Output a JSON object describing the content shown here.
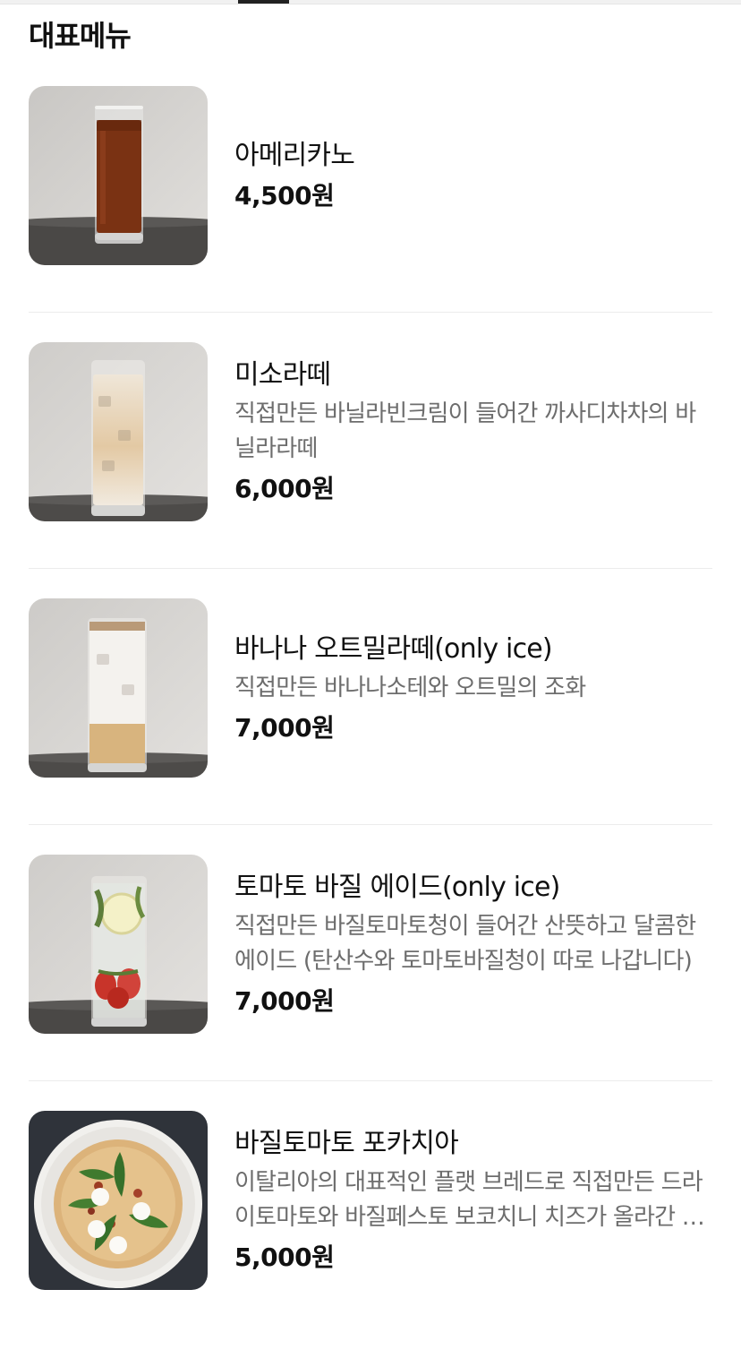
{
  "section": {
    "title": "대표메뉴"
  },
  "menu": [
    {
      "name": "아메리카노",
      "description": "",
      "price": "4,500원",
      "image_icon": "iced-americano-image"
    },
    {
      "name": "미소라떼",
      "description": "직접만든 바닐라빈크림이 들어간 까사디차차의 바닐라라떼",
      "price": "6,000원",
      "image_icon": "iced-latte-image"
    },
    {
      "name": "바나나 오트밀라떼(only ice)",
      "description": "직접만든 바나나소테와 오트밀의 조화",
      "price": "7,000원",
      "image_icon": "banana-oatmeal-latte-image"
    },
    {
      "name": "토마토 바질 에이드(only ice)",
      "description": "직접만든 바질토마토청이 들어간 산뜻하고 달콤한 에이드 (탄산수와 토마토바질청이 따로 나갑니다)",
      "price": "7,000원",
      "image_icon": "tomato-basil-ade-image"
    },
    {
      "name": "바질토마토 포카치아",
      "description": "이탈리아의 대표적인 플랫 브레드로 직접만든 드라이토마토와 바질페스토 보코치니 치즈가 올라간 포카치아",
      "price": "5,000원",
      "image_icon": "focaccia-image"
    }
  ],
  "colors": {
    "background": "#ffffff",
    "text": "#111111",
    "description": "#6d6d6d",
    "divider": "#ececec"
  }
}
